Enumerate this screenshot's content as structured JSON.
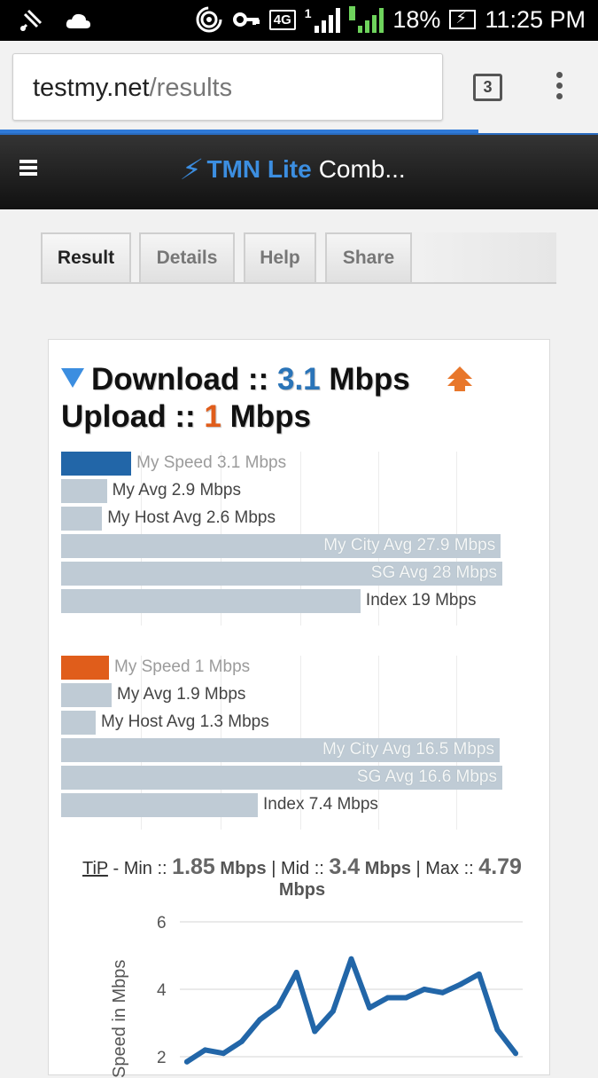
{
  "status": {
    "network": "4G",
    "battery": "18%",
    "time": "11:25 PM",
    "sim2": "2",
    "sim1": "1"
  },
  "browser": {
    "url_domain": "testmy.net",
    "url_path": "/results",
    "tab_count": "3"
  },
  "site": {
    "brand": "TMN Lite",
    "title_rest": "Comb..."
  },
  "tabs": [
    {
      "label": "Result"
    },
    {
      "label": "Details"
    },
    {
      "label": "Help"
    },
    {
      "label": "Share"
    }
  ],
  "summary": {
    "download_label": "Download ::",
    "download_value": "3.1",
    "upload_label": "Upload ::",
    "upload_value": "1",
    "unit": "Mbps"
  },
  "download_bars": [
    {
      "label": "My Speed 3.1 Mbps",
      "value": 3.1
    },
    {
      "label": "My Avg 2.9 Mbps",
      "value": 2.9
    },
    {
      "label": "My Host Avg 2.6 Mbps",
      "value": 2.6
    },
    {
      "label": "My City Avg 27.9 Mbps",
      "value": 27.9
    },
    {
      "label": "SG Avg 28 Mbps",
      "value": 28
    },
    {
      "label": "Index 19 Mbps",
      "value": 19
    }
  ],
  "upload_bars": [
    {
      "label": "My Speed 1 Mbps",
      "value": 1
    },
    {
      "label": "My Avg 1.9 Mbps",
      "value": 1.9
    },
    {
      "label": "My Host Avg 1.3 Mbps",
      "value": 1.3
    },
    {
      "label": "My City Avg 16.5 Mbps",
      "value": 16.5
    },
    {
      "label": "SG Avg 16.6 Mbps",
      "value": 16.6
    },
    {
      "label": "Index 7.4 Mbps",
      "value": 7.4
    }
  ],
  "tip": {
    "link": "TiP",
    "min_label": "- Min ::",
    "min_value": "1.85",
    "mid_label": "| Mid ::",
    "mid_value": "3.4",
    "max_label": "| Max ::",
    "max_value": "4.79",
    "unit": "Mbps"
  },
  "colors": {
    "download": "#2266a8",
    "upload": "#e05d1b",
    "bar": "#bfcbd5",
    "line": "#2266a8"
  },
  "chart_data": {
    "type": "line",
    "ylabel": "Speed in Mbps",
    "ylim": [
      1,
      6
    ],
    "yticks": [
      "2",
      "4",
      "6"
    ],
    "x": [
      1,
      2,
      3,
      4,
      5,
      6,
      7,
      8,
      9,
      10,
      11,
      12,
      13,
      14,
      15,
      16,
      17,
      18,
      19
    ],
    "values": [
      1.85,
      2.2,
      2.1,
      2.45,
      3.1,
      3.5,
      4.5,
      2.75,
      3.35,
      4.9,
      3.45,
      3.75,
      3.75,
      4.0,
      3.9,
      4.15,
      4.45,
      2.8,
      2.1
    ]
  }
}
